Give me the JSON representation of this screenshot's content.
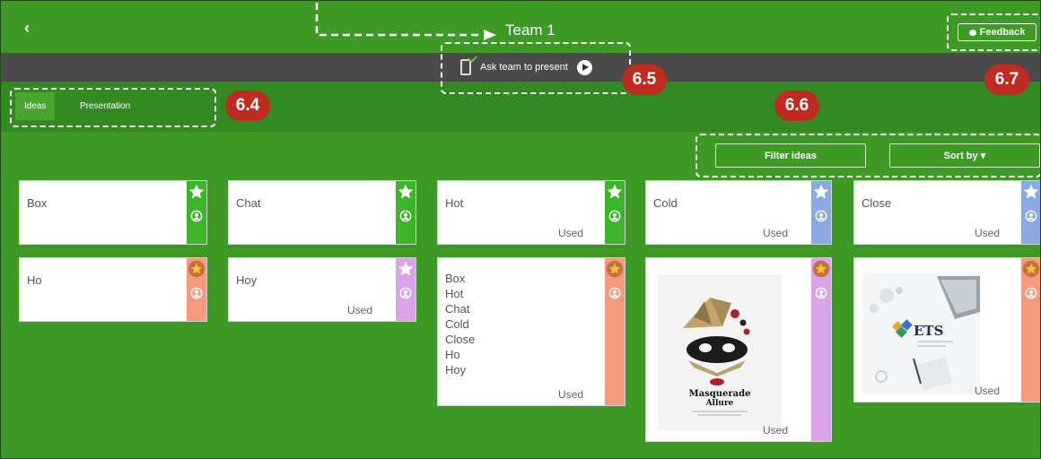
{
  "header": {
    "back_icon": "chevron-left-icon",
    "title": "Team 1",
    "feedback_label": "Feedback",
    "feedback_icon": "speech-bubble-icon"
  },
  "present_bar": {
    "label": "Ask team to present",
    "device_icon": "mobile-check-icon",
    "play_icon": "play-circle-icon"
  },
  "tabs": [
    {
      "label": "Ideas",
      "active": true
    },
    {
      "label": "Presentation",
      "active": false
    }
  ],
  "toolbar": {
    "filter_label": "Filter ideas",
    "sort_label": "Sort by ▾"
  },
  "cards": [
    {
      "text": "Box",
      "status": "",
      "strip_color": "#3db52a",
      "star_filled": false
    },
    {
      "text": "Chat",
      "status": "",
      "strip_color": "#3db52a",
      "star_filled": false
    },
    {
      "text": "Hot",
      "status": "Used",
      "strip_color": "#3db52a",
      "star_filled": false
    },
    {
      "text": "Cold",
      "status": "Used",
      "strip_color": "#8da9e3",
      "star_filled": false
    },
    {
      "text": "Close",
      "status": "Used",
      "strip_color": "#8da9e3",
      "star_filled": false
    },
    {
      "text": "Ho",
      "status": "",
      "strip_color": "#f59a7c",
      "star_filled": true
    },
    {
      "text": "Hoy",
      "status": "Used",
      "strip_color": "#d9a2e9",
      "star_filled": false
    },
    {
      "text": "Box\nHot\nChat\nCold\nClose\nHo\nHoy",
      "status": "Used",
      "strip_color": "#f59a7c",
      "star_filled": true
    },
    {
      "image_title": "Masquerade",
      "image_subtitle": "Allure",
      "status": "Used",
      "strip_color": "#d9a2e9",
      "star_filled": true
    },
    {
      "image_title": "ETS",
      "status": "Used",
      "strip_color": "#f59a7c",
      "star_filled": true
    }
  ],
  "annotations": [
    "6.4",
    "6.5",
    "6.6",
    "6.7"
  ],
  "colors": {
    "background": "#3c9a25",
    "tab_bar": "#338a20",
    "present_bar": "#4a4a4a",
    "annotation": "#bf2a21"
  }
}
